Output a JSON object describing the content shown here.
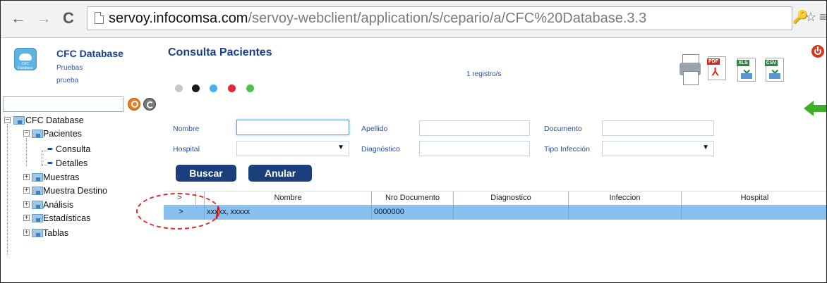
{
  "browser": {
    "back_label": "←",
    "forward_label": "→",
    "reload_label": "C",
    "url_host": "servoy.infocomsa.com",
    "url_path": "/servoy-webclient/application/s/cepario/a/CFC%20Database.3.3",
    "key_label": "🔑",
    "star_label": "☆",
    "menu_label": "≡"
  },
  "sidebar": {
    "logo_text": "CFC Database",
    "title": "CFC Database",
    "subtitle1": "Pruebas",
    "subtitle2": "prueba",
    "search_placeholder": "",
    "tree": {
      "root": "CFC Database",
      "pacientes": "Pacientes",
      "consulta": "Consulta",
      "detalles": "Detalles",
      "muestras": "Muestras",
      "muestra_destino": "Muestra Destino",
      "analisis": "Análisis",
      "estadisticas": "Estadísticas",
      "tablas": "Tablas"
    }
  },
  "main": {
    "title": "Consulta Pacientes",
    "record_count": "1 registro/s",
    "filter_dots": [
      "#c7c7c7",
      "#1a1a1a",
      "#40b4f0",
      "#e0283c",
      "#4cc24a"
    ],
    "exports": {
      "pdf_label": "PDF",
      "xls_label": "XLS",
      "csv_label": "CSV",
      "pdf_color": "#d8261c",
      "xls_color": "#2b8a3e",
      "csv_color": "#2b8a3e"
    },
    "form": {
      "nombre_label": "Nombre",
      "apellido_label": "Apellido",
      "documento_label": "Documento",
      "hospital_label": "Hospital",
      "diagnostico_label": "Diagnóstico",
      "tipo_infeccion_label": "Tipo Infección",
      "select_arrow": "▼"
    },
    "buttons": {
      "buscar": "Buscar",
      "anular": "Anular"
    },
    "table": {
      "headers": [
        ">",
        "Nombre",
        "Nro Documento",
        "Diagnostico",
        "Infeccion",
        "Hospital"
      ],
      "rows": [
        [
          ">",
          "xxxxx, xxxxx",
          "0000000",
          "",
          "",
          ""
        ]
      ]
    }
  },
  "colors": {
    "accent": "#1a3f8c",
    "row_selected": "#89c0f0",
    "button_bg": "#1b3f7a",
    "callout": "#e42a2a"
  }
}
